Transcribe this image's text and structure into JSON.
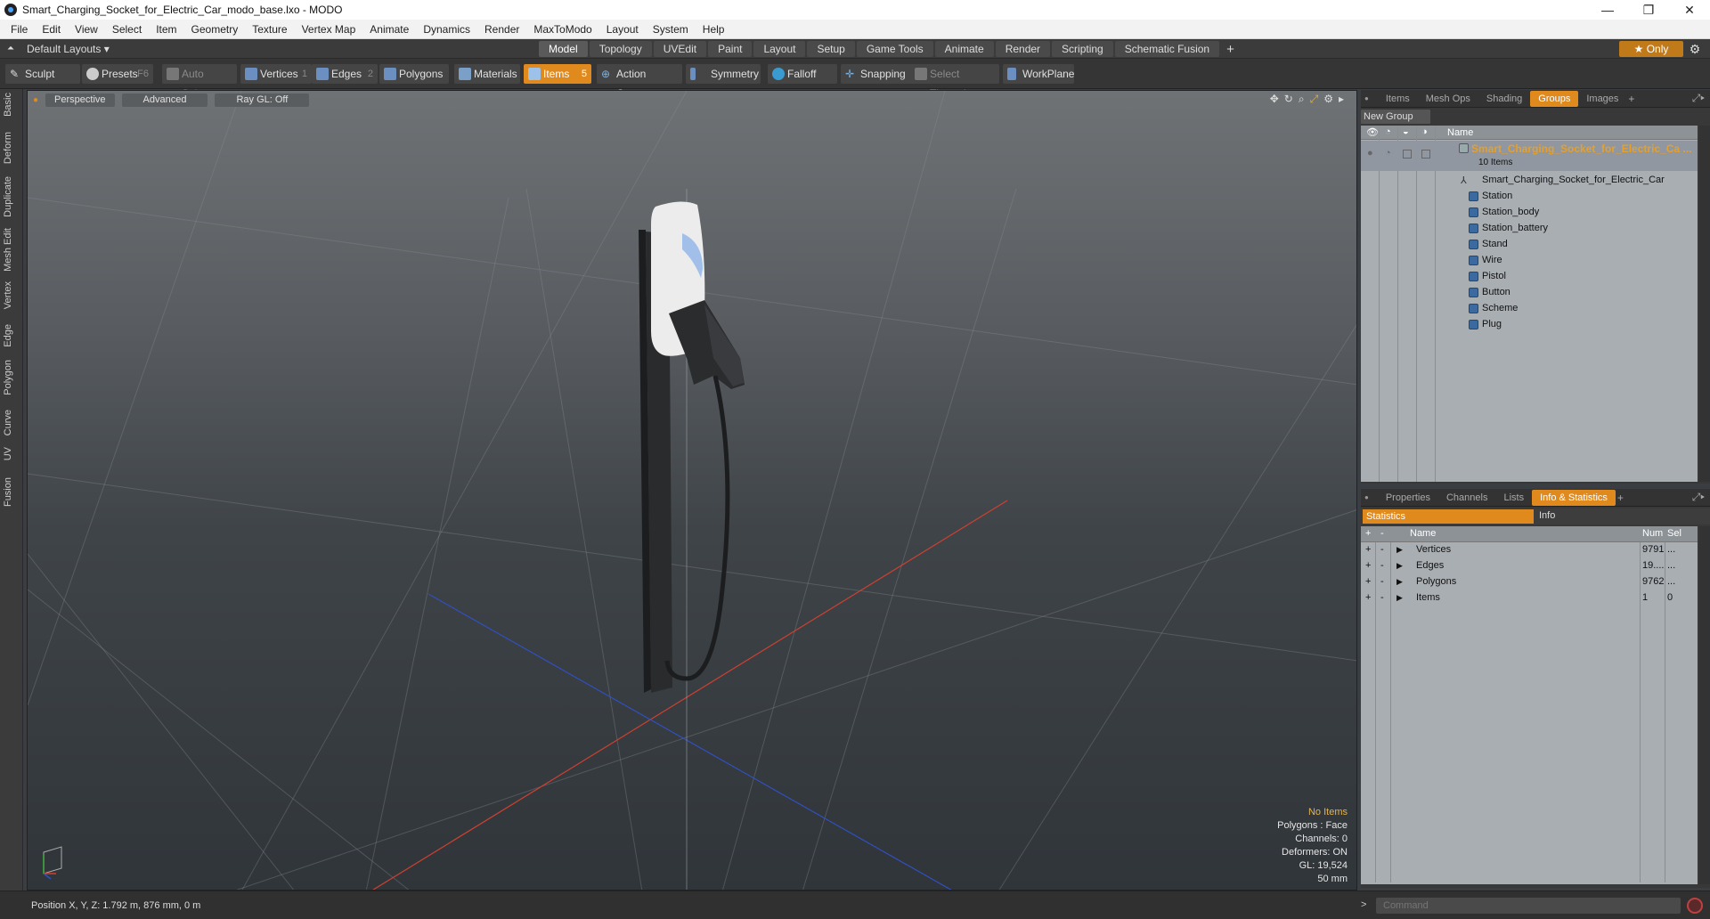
{
  "window": {
    "title": "Smart_Charging_Socket_for_Electric_Car_modo_base.lxo - MODO",
    "minimize": "—",
    "maximize": "❐",
    "close": "✕"
  },
  "menu": [
    "File",
    "Edit",
    "View",
    "Select",
    "Item",
    "Geometry",
    "Texture",
    "Vertex Map",
    "Animate",
    "Dynamics",
    "Render",
    "MaxToModo",
    "Layout",
    "System",
    "Help"
  ],
  "layoutbar": {
    "preset": "Default Layouts ▾",
    "tabs": [
      "Model",
      "Topology",
      "UVEdit",
      "Paint",
      "Layout",
      "Setup",
      "Game Tools",
      "Animate",
      "Render",
      "Scripting",
      "Schematic Fusion"
    ],
    "active_tab": "Model",
    "add": "+",
    "only": "★  Only"
  },
  "toolbar": {
    "sculpt": "Sculpt",
    "presets": "Presets",
    "presets_key": "F6",
    "auto_select": "Auto Select",
    "vertices": "Vertices",
    "vertices_key": "1",
    "edges": "Edges",
    "edges_key": "2",
    "polygons": "Polygons",
    "materials": "Materials",
    "items": "Items",
    "items_key": "5",
    "action_center": "Action Center",
    "symmetry": "Symmetry",
    "falloff": "Falloff",
    "snapping": "Snapping",
    "select_through": "Select Through",
    "workplane": "WorkPlane"
  },
  "left_tabs": [
    "Basic",
    "Deform",
    "Duplicate",
    "Mesh Edit",
    "Vertex",
    "Edge",
    "Polygon",
    "Curve",
    "UV",
    "Fusion"
  ],
  "viewport": {
    "perspective": "Perspective",
    "advanced": "Advanced",
    "raygl": "Ray GL: Off",
    "info": {
      "no_items": "No Items",
      "polygons": "Polygons : Face",
      "channels": "Channels: 0",
      "deformers": "Deformers: ON",
      "gl": "GL: 19,524",
      "scale": "50 mm"
    }
  },
  "status": {
    "position": "Position X, Y, Z:   1.792 m, 876 mm, 0 m",
    "command_placeholder": "Command",
    "prompt": ">"
  },
  "groups_panel": {
    "tabs": [
      "Items",
      "Mesh Ops",
      "Shading",
      "Groups",
      "Images"
    ],
    "active_tab": "Groups",
    "new_group": "New Group",
    "name_header": "Name",
    "root": {
      "label": "Smart_Charging_Socket_for_Electric_Ca ...",
      "count": "10 Items"
    },
    "items": [
      "Smart_Charging_Socket_for_Electric_Car",
      "Station",
      "Station_body",
      "Station_battery",
      "Stand",
      "Wire",
      "Pistol",
      "Button",
      "Scheme",
      "Plug"
    ]
  },
  "stats_panel": {
    "tabs": [
      "Properties",
      "Channels",
      "Lists",
      "Info & Statistics"
    ],
    "active_tab": "Info & Statistics",
    "sub_tabs": {
      "statistics": "Statistics",
      "info": "Info"
    },
    "headers": {
      "name": "Name",
      "num": "Num",
      "sel": "Sel"
    },
    "rows": [
      {
        "name": "Vertices",
        "num": "9791",
        "sel": "..."
      },
      {
        "name": "Edges",
        "num": "19....",
        "sel": "..."
      },
      {
        "name": "Polygons",
        "num": "9762",
        "sel": "..."
      },
      {
        "name": "Items",
        "num": "1",
        "sel": "0"
      }
    ]
  },
  "colors": {
    "accent": "#e08a1e",
    "root_label": "#e6a02a",
    "x_axis": "#d04030",
    "z_axis": "#3050c0"
  }
}
